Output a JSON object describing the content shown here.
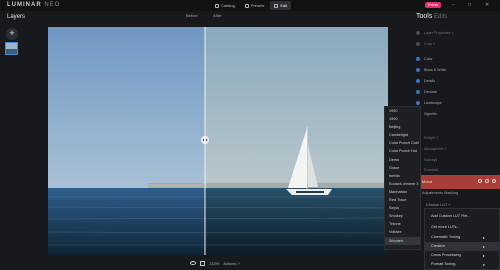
{
  "app": {
    "logo_main": "LUMINAR",
    "logo_sub": "NEO",
    "tabs": [
      {
        "label": "Catalog",
        "icon": "catalog-icon",
        "active": false
      },
      {
        "label": "Presets",
        "icon": "presets-icon",
        "active": false
      },
      {
        "label": "Edit",
        "icon": "edit-icon",
        "active": true
      }
    ],
    "upgrade_label": "Extras",
    "window_controls": [
      "−",
      "□",
      "✕"
    ]
  },
  "layers": {
    "title": "Layers",
    "add_label": "+"
  },
  "canvas": {
    "before_label": "Before",
    "after_label": "After"
  },
  "bottombar": {
    "zoom": "132%",
    "actions_label": "Actions ˅"
  },
  "tools": {
    "title": "Tools",
    "edits_label": "Edits",
    "rows": [
      {
        "label": "Layer Properties ˅",
        "dot": "gray",
        "dim": true
      },
      {
        "label": "Crop ˅",
        "dot": "gray",
        "dim": true
      },
      {
        "label": "Color",
        "dot": "blue",
        "dim": false
      },
      {
        "label": "Black & White",
        "dot": "blue",
        "dim": false
      },
      {
        "label": "Details",
        "dot": "blue",
        "dim": false
      },
      {
        "label": "Denoise",
        "dot": "blue",
        "dim": false
      },
      {
        "label": "Landscape",
        "dot": "blue",
        "dim": false
      },
      {
        "label": "Vignette",
        "dot": "blue",
        "dim": false
      }
    ],
    "faded_rows": [
      "ols",
      "Relight ˅",
      "Atmosphere ˅",
      "Sunrays",
      "Dramatic"
    ],
    "active_tool": "Mood",
    "sub_tabs": "Adjustments    Masking",
    "lut_select": "Choose LUT ˅",
    "bottom_row": "Amount"
  },
  "lut_list": [
    "1950",
    "1990",
    "Beijing",
    "Candlelight",
    "Color Punch Cold",
    "Color Punch Hot",
    "Demo",
    "Grace",
    "Inertia",
    "Kodack chrome 3",
    "Manhattan",
    "Red Trace",
    "Sepia",
    "Smokey",
    "Tritone",
    "Voltaire",
    "Wooden"
  ],
  "lut_hover": "Wooden",
  "context_menu": [
    {
      "label": "Add Custom LUT File...",
      "arrow": false,
      "highlight": false
    },
    {
      "label": "Get more LUTs...",
      "arrow": false,
      "highlight": false
    },
    {
      "label": "Cinematic Toning",
      "arrow": true,
      "highlight": false
    },
    {
      "label": "Creative",
      "arrow": true,
      "highlight": true
    },
    {
      "label": "Cross Processing",
      "arrow": true,
      "highlight": false
    },
    {
      "label": "Portrait Toning",
      "arrow": true,
      "highlight": false
    }
  ],
  "colors": {
    "accent": "#3a73c4",
    "upgrade": "#e0306b",
    "active_tool_bg": "#a83e3a"
  }
}
